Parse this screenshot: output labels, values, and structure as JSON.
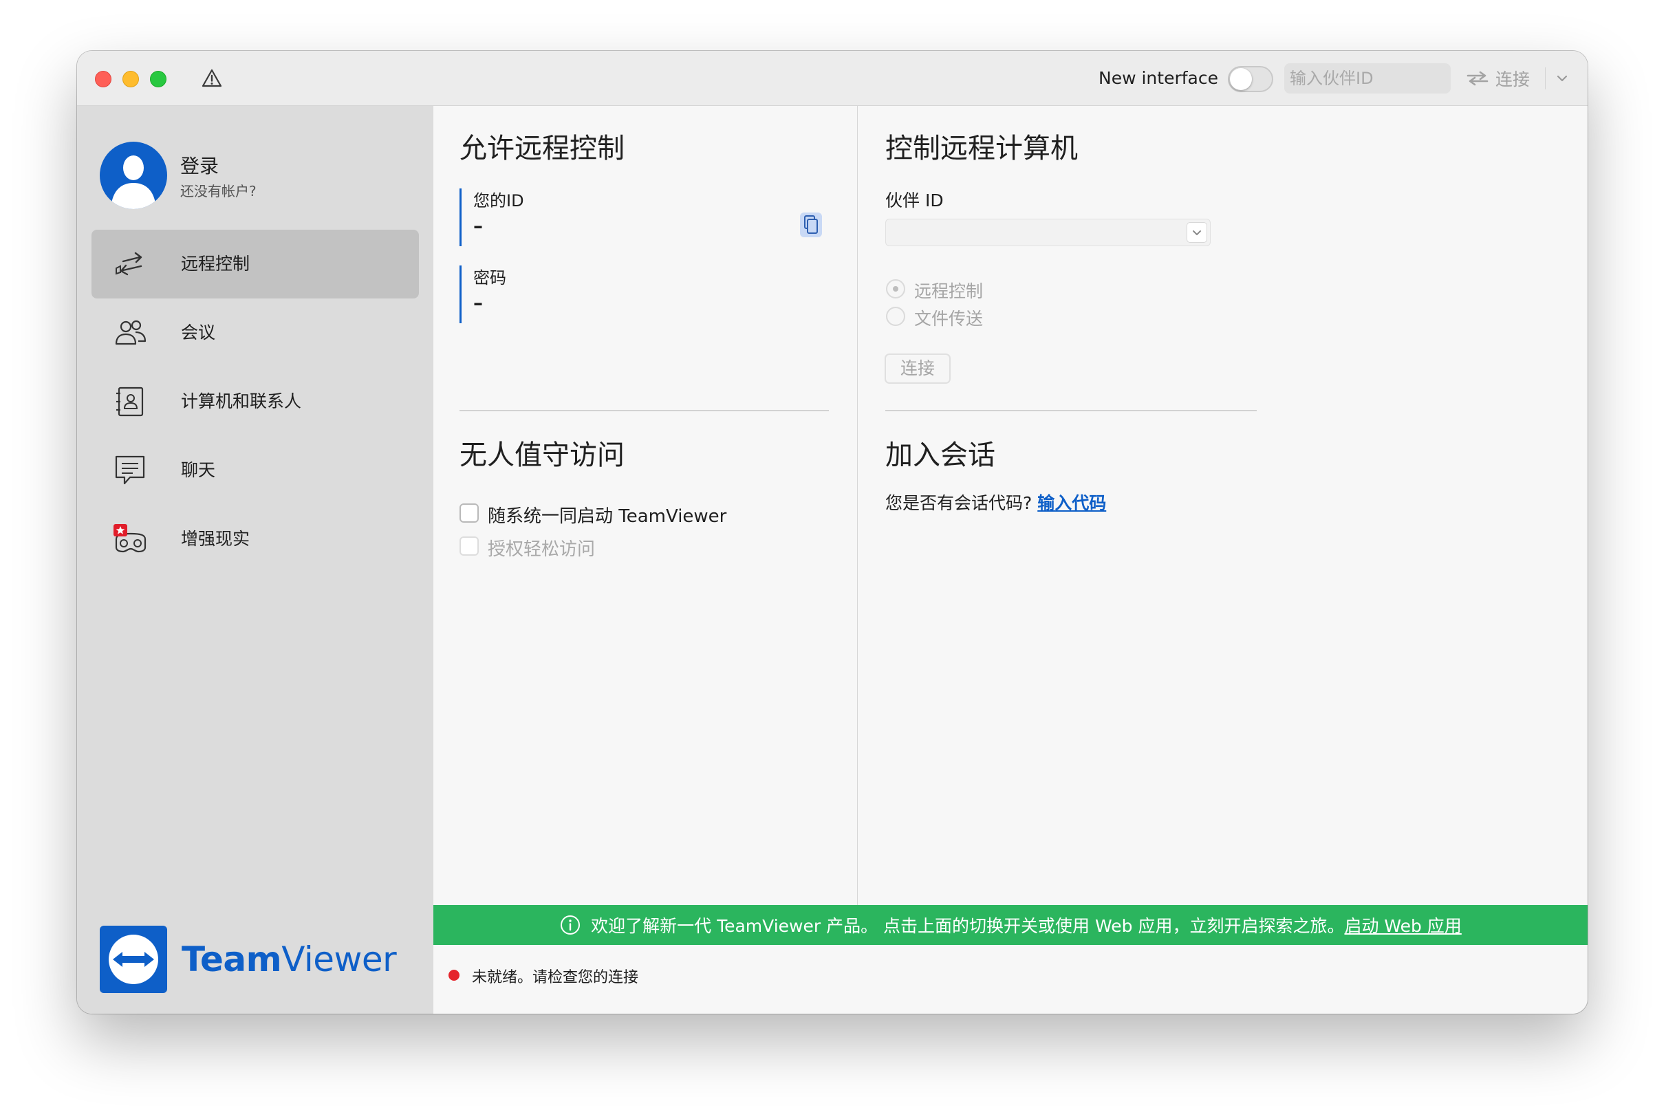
{
  "window": {
    "new_interface_label": "New interface",
    "partner_id_placeholder": "输入伙伴ID",
    "connect_label": "连接"
  },
  "sidebar": {
    "login_title": "登录",
    "login_subtitle": "还没有帐户?",
    "items": [
      {
        "label": "远程控制",
        "icon": "remote-control-arrows-icon",
        "active": true
      },
      {
        "label": "会议",
        "icon": "people-icon",
        "active": false
      },
      {
        "label": "计算机和联系人",
        "icon": "contact-book-icon",
        "active": false
      },
      {
        "label": "聊天",
        "icon": "chat-bubble-icon",
        "active": false
      },
      {
        "label": "增强现实",
        "icon": "ar-goggles-icon",
        "active": false
      }
    ],
    "logo_bold": "Team",
    "logo_regular": "Viewer"
  },
  "allow_remote": {
    "title": "允许远程控制",
    "id_label": "您的ID",
    "id_value": "–",
    "password_label": "密码",
    "password_value": "–"
  },
  "unattended": {
    "title": "无人值守访问",
    "start_with_system_label": "随系统一同启动 TeamViewer",
    "start_with_system_checked": false,
    "grant_easy_access_label": "授权轻松访问",
    "grant_easy_access_checked": false
  },
  "control_remote": {
    "title": "控制远程计算机",
    "partner_id_label": "伙伴 ID",
    "partner_id_value": "",
    "radio_remote_control": "远程控制",
    "radio_file_transfer": "文件传送",
    "selected_mode": "远程控制",
    "connect_button": "连接"
  },
  "join_session": {
    "title": "加入会话",
    "question": "您是否有会话代码?",
    "link": "输入代码"
  },
  "banner": {
    "text": "欢迎了解新一代 TeamViewer 产品。 点击上面的切换开关或使用 Web 应用，立刻开启探索之旅。",
    "link": "启动 Web 应用"
  },
  "status": {
    "text": "未就绪。请检查您的连接",
    "color": "#e5242b"
  },
  "colors": {
    "brand_blue": "#0e5fc8",
    "banner_green": "#2bb55e",
    "sidebar_bg": "#dcdcdc",
    "active_item_bg": "#c2c2c2"
  }
}
